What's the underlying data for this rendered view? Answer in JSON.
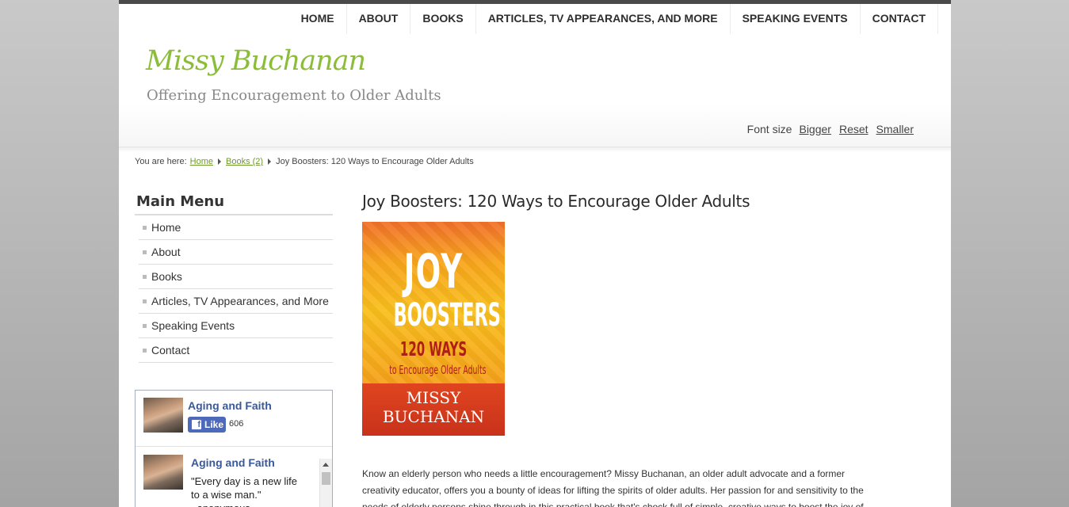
{
  "nav": {
    "items": [
      {
        "label": "HOME"
      },
      {
        "label": "ABOUT"
      },
      {
        "label": "BOOKS"
      },
      {
        "label": "ARTICLES, TV APPEARANCES, AND MORE"
      },
      {
        "label": "SPEAKING EVENTS"
      },
      {
        "label": "CONTACT"
      }
    ]
  },
  "site": {
    "title": "Missy Buchanan",
    "tagline": "Offering Encouragement to Older Adults"
  },
  "fontsize": {
    "label": "Font size",
    "bigger": "Bigger",
    "reset": "Reset",
    "smaller": "Smaller"
  },
  "breadcrumb": {
    "prefix": "You are here:",
    "items": [
      {
        "label": "Home"
      },
      {
        "label": "Books (2)"
      }
    ],
    "current": "Joy Boosters: 120 Ways to Encourage Older Adults"
  },
  "sidebar": {
    "title": "Main Menu",
    "items": [
      {
        "label": "Home"
      },
      {
        "label": "About"
      },
      {
        "label": "Books"
      },
      {
        "label": "Articles, TV Appearances, and More"
      },
      {
        "label": "Speaking Events"
      },
      {
        "label": "Contact"
      }
    ]
  },
  "facebook": {
    "page_name": "Aging and Faith",
    "like_label": "Like",
    "like_count": "606",
    "post_author": "Aging and Faith",
    "post_text": "\"Every day is a new life to a wise man.\" ~anonymous"
  },
  "article": {
    "title": "Joy Boosters: 120 Ways to Encourage Older Adults",
    "cover": {
      "line1": "JOY",
      "line2": "BOOSTERS",
      "line3": "120 WAYS",
      "line4": "to Encourage Older Adults",
      "author_line1": "MISSY",
      "author_line2": "BUCHANAN"
    },
    "body": "Know an elderly person who needs a little encouragement? Missy Buchanan, an older adult advocate and a former creativity educator, offers you a bounty of ideas for lifting the spirits of older adults. Her passion for and sensitivity to the needs of elderly persons shine through in this practical book that's chock full of simple, creative ways to boost the joy of"
  },
  "colors": {
    "accent_green": "#8cbd3a",
    "link_green": "#6f9a2c",
    "facebook_blue": "#3b5998",
    "cover_orange": "#f8b81c",
    "cover_red": "#c8321b"
  }
}
